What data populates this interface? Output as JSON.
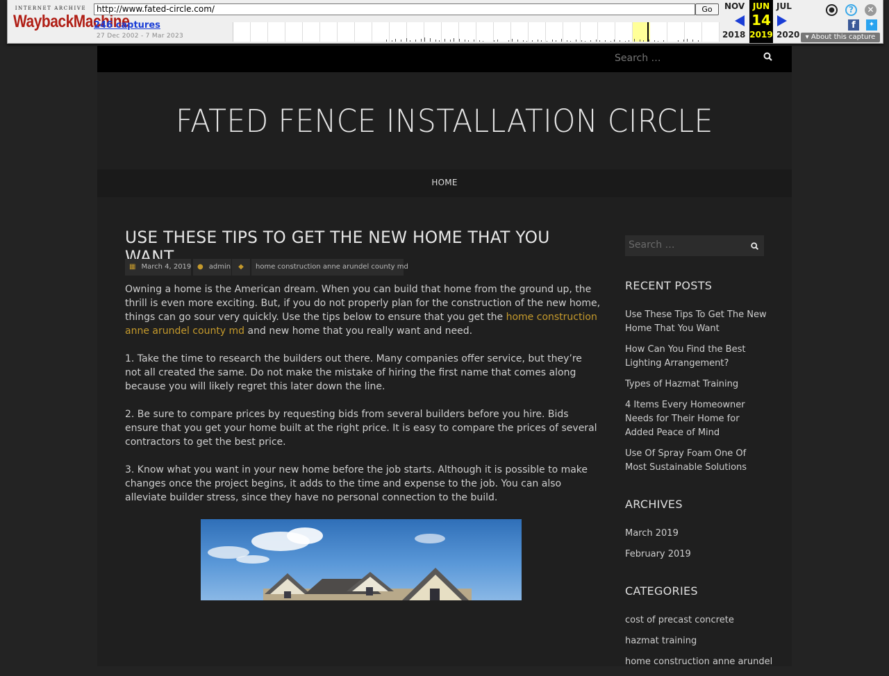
{
  "wayback": {
    "logo_top": "INTERNET ARCHIVE",
    "logo_main": "WaybackMachine",
    "url": "http://www.fated-circle.com/",
    "go_label": "Go",
    "captures": "246 captures",
    "range": "27 Dec 2002 - 7 Mar 2023",
    "prev_month": "NOV",
    "prev_year": "2018",
    "cur_month": "JUN",
    "cur_day": "14",
    "cur_year": "2019",
    "next_month": "JUL",
    "next_year": "2020",
    "about": "About this capture",
    "icons": [
      "user-icon",
      "help-icon",
      "close-icon",
      "facebook-icon",
      "twitter-icon"
    ]
  },
  "site": {
    "top_search_placeholder": "Search …",
    "title": "FATED FENCE INSTALLATION CIRCLE",
    "nav": [
      "HOME"
    ],
    "accent": "#c59a2c"
  },
  "post": {
    "title": "USE THESE TIPS TO GET THE NEW HOME THAT YOU WANT",
    "date": "March 4, 2019",
    "author": "admin",
    "tag": "home construction anne arundel county md",
    "p1_a": "Owning a home is the American dream. When you can build that home from the ground up, the thrill is even more exciting. But, if you do not properly plan for the construction of the new home, things can go sour very quickly. Use the tips below to ensure that you get the ",
    "p1_link": "home construction anne arundel county md",
    "p1_b": " and new home that you really want and need.",
    "p2": "1.    Take the time to research the builders out there. Many companies offer service, but they’re not all created the same. Do not make the mistake of hiring the first name that comes along because you will likely regret this later down the line.",
    "p3": "2.    Be sure to compare prices by requesting bids from several builders before you hire. Bids ensure that you get your home built at the right price. It is easy to compare the prices of several contractors to get the best price.",
    "p4": "3.    Know what you want in your new home before the job starts. Although it is possible to make changes once the project begins, it adds to the time and expense to the job. You can also alleviate builder stress, since they have no personal connection to the build."
  },
  "sidebar": {
    "search_placeholder": "Search …",
    "recent_title": "RECENT POSTS",
    "recent": [
      "Use These Tips To Get The New Home That You Want",
      "How Can You Find the Best Lighting Arrangement?",
      "Types of Hazmat Training",
      "4 Items Every Homeowner Needs for Their Home for Added Peace of Mind",
      "Use Of Spray Foam One Of Most Sustainable Solutions"
    ],
    "archives_title": "ARCHIVES",
    "archives": [
      "March 2019",
      "February 2019"
    ],
    "categories_title": "CATEGORIES",
    "categories": [
      "cost of precast concrete",
      "hazmat training",
      "home construction anne arundel"
    ]
  }
}
